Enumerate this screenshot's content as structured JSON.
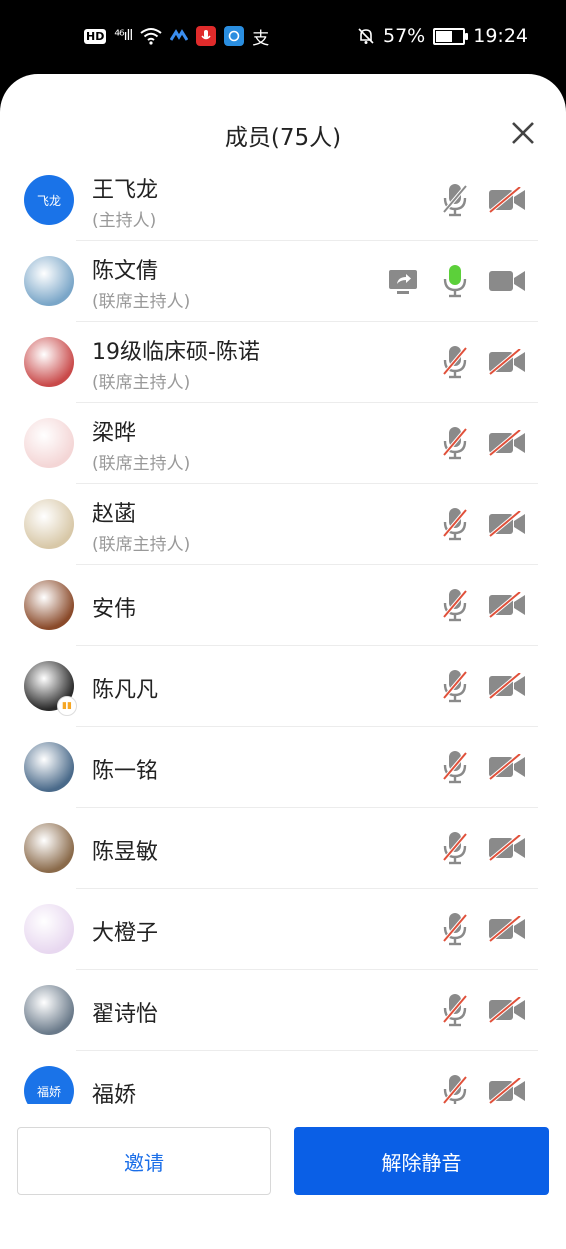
{
  "status_bar": {
    "left_icons": [
      "hd-icon",
      "signal-4g-icon",
      "wifi-icon",
      "app-icon-1",
      "app-icon-2",
      "app-icon-3",
      "alipay-icon"
    ],
    "hd_label": "HD",
    "net_label": "⁴⁶ıll",
    "alipay_glyph": "支",
    "battery_percent": "57%",
    "battery_level": 0.57,
    "time": "19:24"
  },
  "panel": {
    "title": "成员(75人)"
  },
  "members": [
    {
      "name": "王飞龙",
      "role": "(主持人)",
      "avatar_text": "飞龙",
      "avatar_color": "#1a73e8",
      "mic": "off-gray",
      "camera": "off",
      "sharing": false
    },
    {
      "name": "陈文倩",
      "role": "(联席主持人)",
      "avatar_color": "#7aa6c8",
      "mic": "on-green",
      "camera": "on",
      "sharing": true
    },
    {
      "name": "19级临床硕-陈诺",
      "role": "(联席主持人)",
      "avatar_color": "#c94a4a",
      "mic": "off",
      "camera": "off",
      "sharing": false
    },
    {
      "name": "梁晔",
      "role": "(联席主持人)",
      "avatar_color": "#f4d6d6",
      "mic": "off",
      "camera": "off",
      "sharing": false
    },
    {
      "name": "赵菡",
      "role": "(联席主持人)",
      "avatar_color": "#d8c8a8",
      "mic": "off",
      "camera": "off",
      "sharing": false
    },
    {
      "name": "安伟",
      "role": "",
      "avatar_color": "#8a4a2a",
      "mic": "off",
      "camera": "off",
      "sharing": false
    },
    {
      "name": "陈凡凡",
      "role": "",
      "avatar_color": "#2a2a2a",
      "mic": "off",
      "camera": "off",
      "sharing": false,
      "badge": true
    },
    {
      "name": "陈一铭",
      "role": "",
      "avatar_color": "#4a6a8a",
      "mic": "off",
      "camera": "off",
      "sharing": false
    },
    {
      "name": "陈昱敏",
      "role": "",
      "avatar_color": "#8a6a4a",
      "mic": "off",
      "camera": "off",
      "sharing": false
    },
    {
      "name": "大橙子",
      "role": "",
      "avatar_color": "#e8d8f0",
      "mic": "off",
      "camera": "off",
      "sharing": false
    },
    {
      "name": "翟诗怡",
      "role": "",
      "avatar_color": "#6a7a8a",
      "mic": "off",
      "camera": "off",
      "sharing": false
    },
    {
      "name": "福娇",
      "role": "",
      "avatar_text": "福娇",
      "avatar_color": "#1a73e8",
      "mic": "off",
      "camera": "off",
      "sharing": false
    }
  ],
  "buttons": {
    "invite": "邀请",
    "unmute": "解除静音"
  },
  "colors": {
    "accent": "#0a5fe6",
    "mic_active": "#5cd03a",
    "slash_red": "#e0503a",
    "icon_gray": "#8a8a8a"
  }
}
